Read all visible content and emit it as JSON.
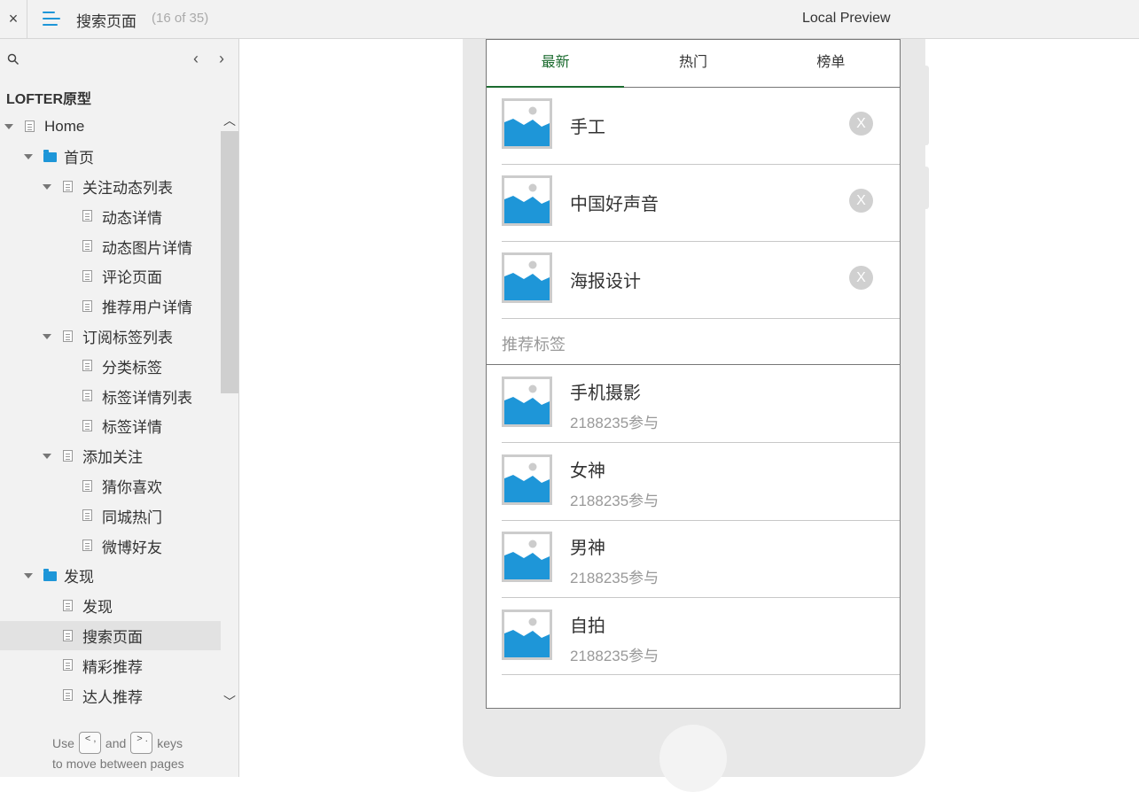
{
  "topbar": {
    "close_label": "×",
    "page_title": "搜索页面",
    "page_count": "(16 of 35)",
    "preview_label": "Local Preview"
  },
  "sidebar": {
    "project_title": "LOFTER原型",
    "prev_arrow": "‹",
    "next_arrow": "›",
    "tree": [
      {
        "label": "Home",
        "type": "page",
        "level": 0,
        "expanded": true
      },
      {
        "label": "首页",
        "type": "folder",
        "level": 1,
        "expanded": true
      },
      {
        "label": "关注动态列表",
        "type": "page",
        "level": 2,
        "expanded": true
      },
      {
        "label": "动态详情",
        "type": "page",
        "level": 3
      },
      {
        "label": "动态图片详情",
        "type": "page",
        "level": 3
      },
      {
        "label": "评论页面",
        "type": "page",
        "level": 3
      },
      {
        "label": "推荐用户详情",
        "type": "page",
        "level": 3
      },
      {
        "label": "订阅标签列表",
        "type": "page",
        "level": 2,
        "expanded": true
      },
      {
        "label": "分类标签",
        "type": "page",
        "level": 3
      },
      {
        "label": "标签详情列表",
        "type": "page",
        "level": 3
      },
      {
        "label": "标签详情",
        "type": "page",
        "level": 3
      },
      {
        "label": "添加关注",
        "type": "page",
        "level": 2,
        "expanded": true
      },
      {
        "label": "猜你喜欢",
        "type": "page",
        "level": 3
      },
      {
        "label": "同城热门",
        "type": "page",
        "level": 3
      },
      {
        "label": "微博好友",
        "type": "page",
        "level": 3
      },
      {
        "label": "发现",
        "type": "folder",
        "level": 1,
        "expanded": true
      },
      {
        "label": "发现",
        "type": "page",
        "level": 2
      },
      {
        "label": "搜索页面",
        "type": "page",
        "level": 2,
        "selected": true
      },
      {
        "label": "精彩推荐",
        "type": "page",
        "level": 2
      },
      {
        "label": "达人推荐",
        "type": "page",
        "level": 2
      }
    ],
    "hint": {
      "use": "Use",
      "key_prev": "< ,",
      "and": "and",
      "key_next": "> .",
      "keys": "keys",
      "line2": "to move between pages"
    }
  },
  "screen": {
    "tabs": [
      {
        "label": "最新",
        "active": true
      },
      {
        "label": "热门",
        "active": false
      },
      {
        "label": "榜单",
        "active": false
      }
    ],
    "history": [
      {
        "name": "手工",
        "remove": "X"
      },
      {
        "name": "中国好声音",
        "remove": "X"
      },
      {
        "name": "海报设计",
        "remove": "X"
      }
    ],
    "recommended_header": "推荐标签",
    "recommended": [
      {
        "name": "手机摄影",
        "sub": "2188235参与"
      },
      {
        "name": "女神",
        "sub": "2188235参与"
      },
      {
        "name": "男神",
        "sub": "2188235参与"
      },
      {
        "name": "自拍",
        "sub": "2188235参与"
      }
    ]
  },
  "colors": {
    "accent": "#1e96d8",
    "tab_active": "#1b6b2f",
    "sidebar_bg": "#f2f2f2"
  }
}
